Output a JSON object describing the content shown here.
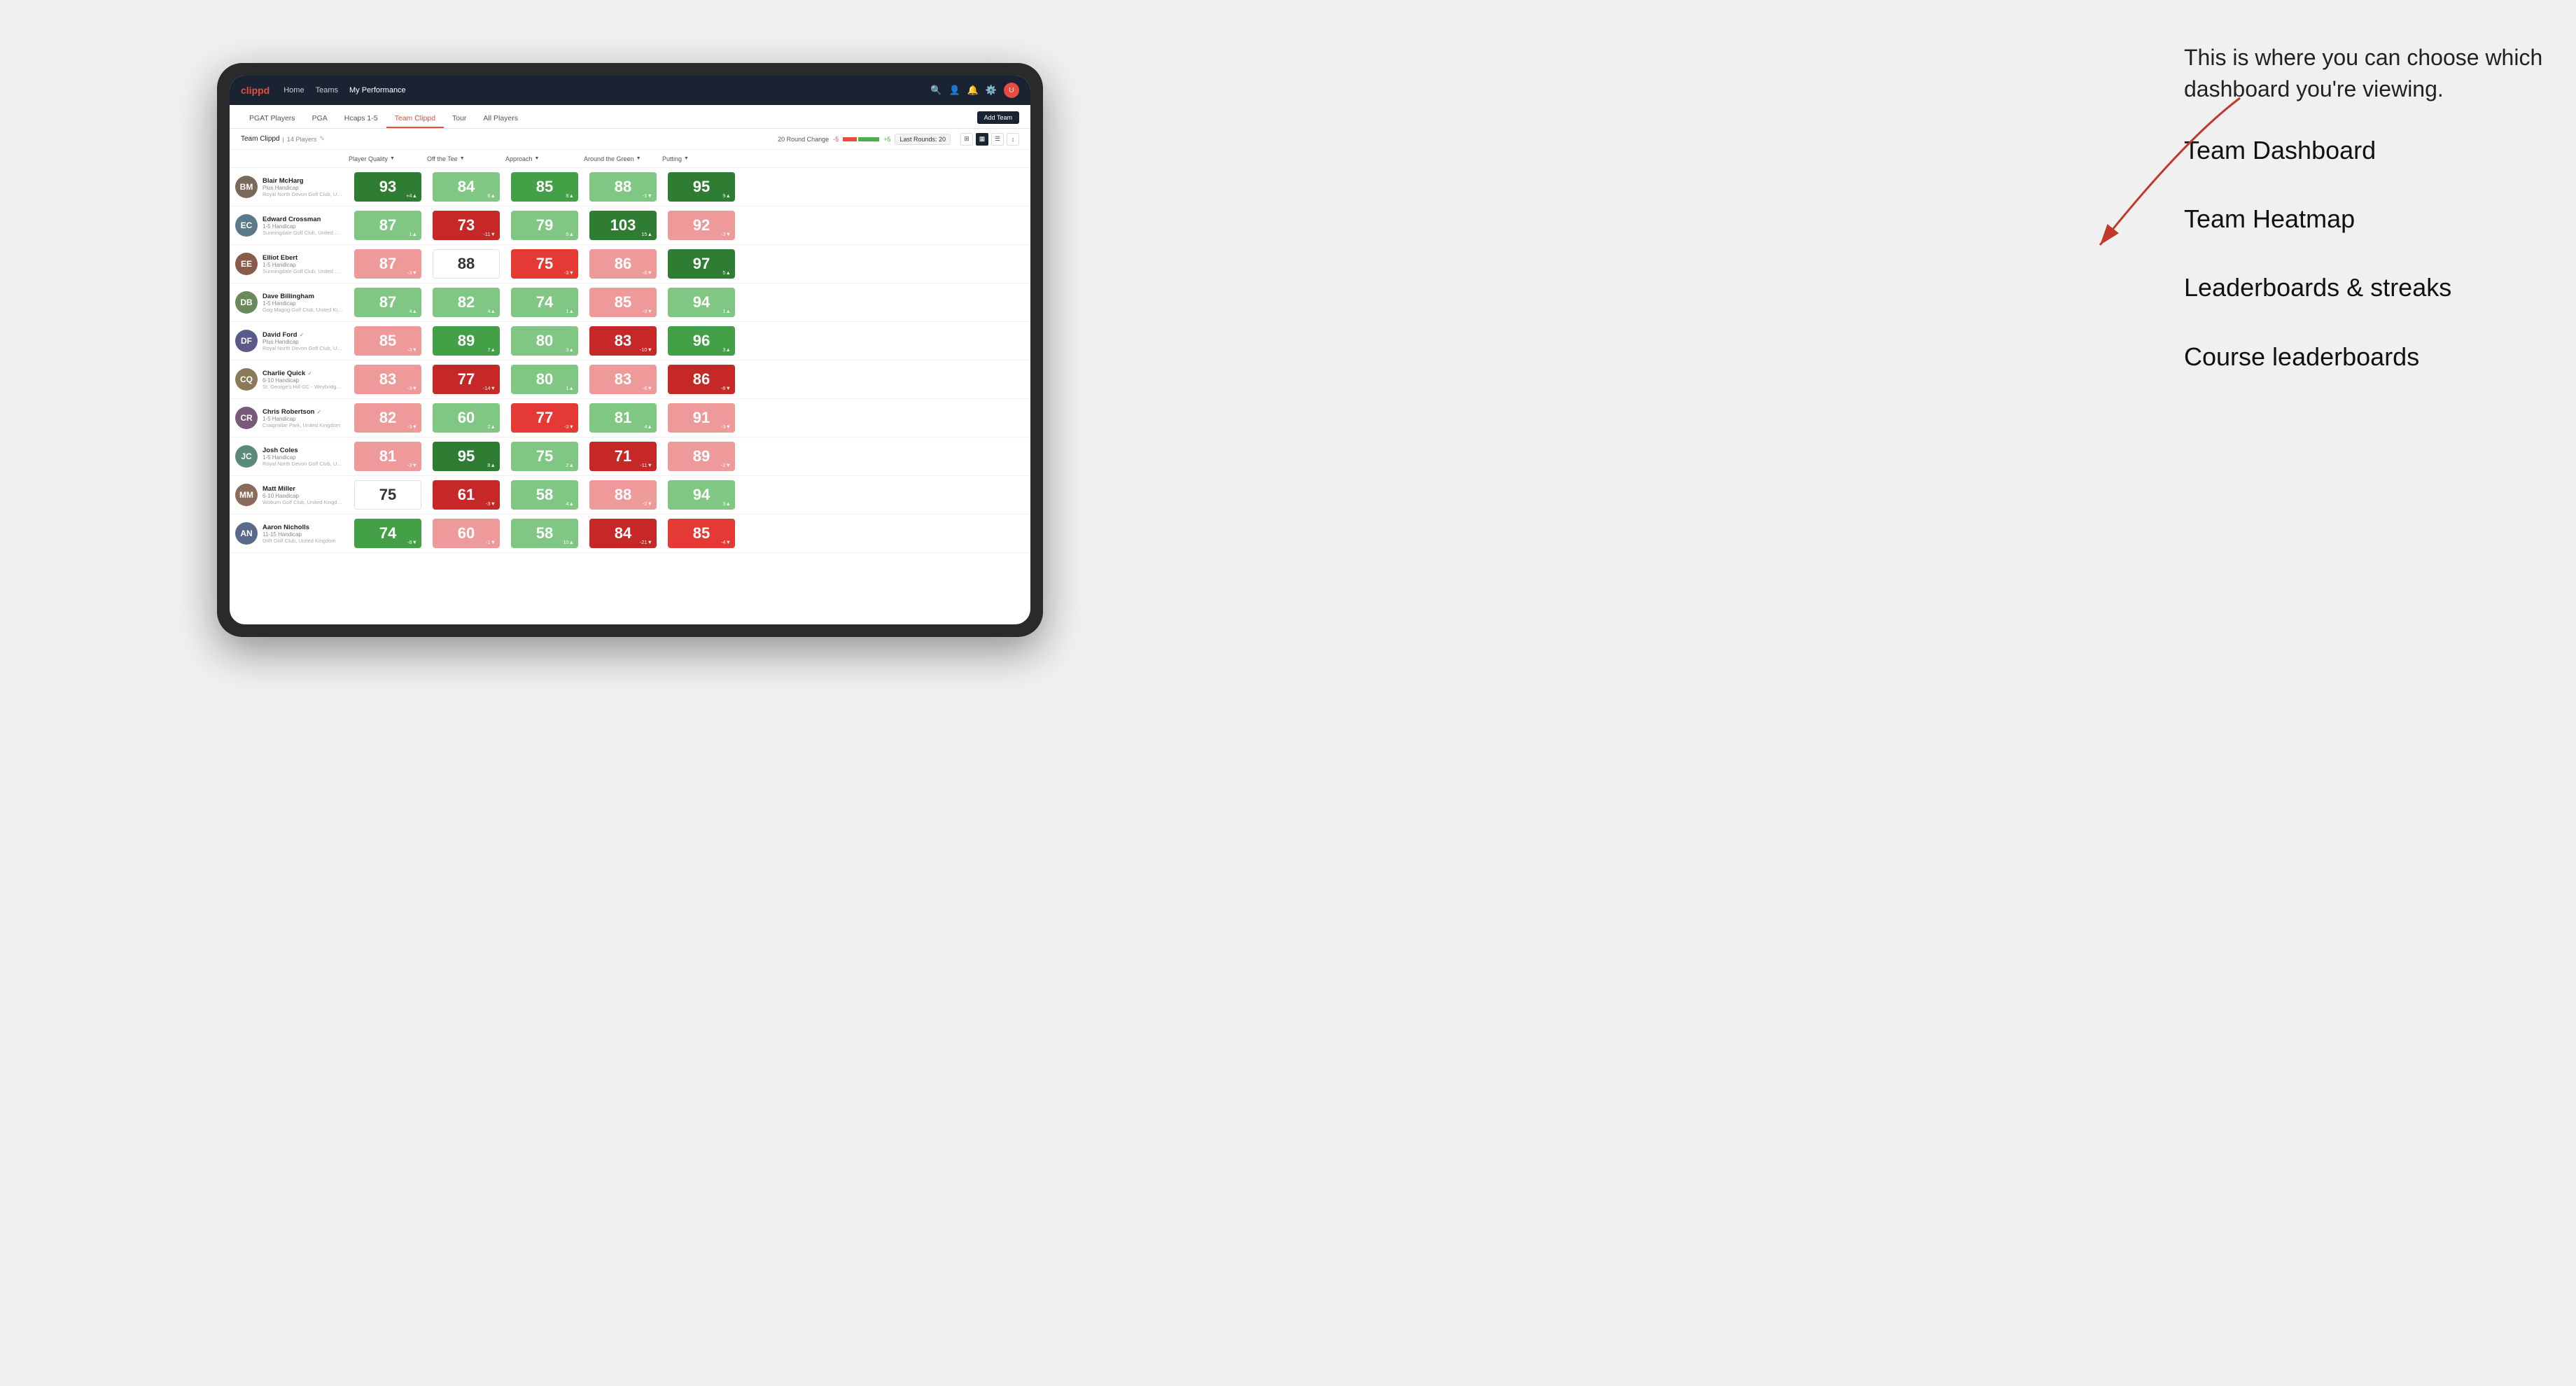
{
  "annotation": {
    "intro": "This is where you can choose which dashboard you're viewing.",
    "items": [
      "Team Dashboard",
      "Team Heatmap",
      "Leaderboards & streaks",
      "Course leaderboards"
    ]
  },
  "nav": {
    "logo": "clippd",
    "items": [
      "Home",
      "Teams",
      "My Performance"
    ],
    "active": "My Performance"
  },
  "sub_tabs": {
    "tabs": [
      "PGAT Players",
      "PGA",
      "Hcaps 1-5",
      "Team Clippd",
      "Tour",
      "All Players"
    ],
    "active": "Team Clippd",
    "add_team": "Add Team"
  },
  "team_bar": {
    "name": "Team Clippd",
    "separator": "|",
    "count": "14 Players",
    "round_change_label": "20 Round Change",
    "neg_label": "-5",
    "pos_label": "+5",
    "last_rounds": "Last Rounds: 20"
  },
  "column_headers": {
    "player": "Player Quality",
    "tee": "Off the Tee",
    "approach": "Approach",
    "green": "Around the Green",
    "putting": "Putting"
  },
  "players": [
    {
      "name": "Blair McHarg",
      "handicap": "Plus Handicap",
      "club": "Royal North Devon Golf Club, United Kingdom",
      "avatar_color": "#7a6a5a",
      "initials": "BM",
      "quality": {
        "value": 93,
        "change": "+4",
        "dir": "up",
        "color": "green-dark"
      },
      "tee": {
        "value": 84,
        "change": "6",
        "dir": "up",
        "color": "green-light"
      },
      "approach": {
        "value": 85,
        "change": "8",
        "dir": "up",
        "color": "green-mid"
      },
      "green": {
        "value": 88,
        "change": "-1",
        "dir": "down",
        "color": "green-light"
      },
      "putting": {
        "value": 95,
        "change": "9",
        "dir": "up",
        "color": "green-dark"
      }
    },
    {
      "name": "Edward Crossman",
      "handicap": "1-5 Handicap",
      "club": "Sunningdale Golf Club, United Kingdom",
      "avatar_color": "#5a7a8a",
      "initials": "EC",
      "quality": {
        "value": 87,
        "change": "1",
        "dir": "up",
        "color": "green-light"
      },
      "tee": {
        "value": 73,
        "change": "-11",
        "dir": "down",
        "color": "red-dark"
      },
      "approach": {
        "value": 79,
        "change": "9",
        "dir": "up",
        "color": "green-light"
      },
      "green": {
        "value": 103,
        "change": "15",
        "dir": "up",
        "color": "green-dark"
      },
      "putting": {
        "value": 92,
        "change": "-3",
        "dir": "down",
        "color": "red-light"
      }
    },
    {
      "name": "Elliot Ebert",
      "handicap": "1-5 Handicap",
      "club": "Sunningdale Golf Club, United Kingdom",
      "avatar_color": "#8a5a4a",
      "initials": "EE",
      "quality": {
        "value": 87,
        "change": "-3",
        "dir": "down",
        "color": "red-light"
      },
      "tee": {
        "value": 88,
        "change": "",
        "dir": "neutral",
        "color": "neutral"
      },
      "approach": {
        "value": 75,
        "change": "-3",
        "dir": "down",
        "color": "red-mid"
      },
      "green": {
        "value": 86,
        "change": "-6",
        "dir": "down",
        "color": "red-light"
      },
      "putting": {
        "value": 97,
        "change": "5",
        "dir": "up",
        "color": "green-dark"
      }
    },
    {
      "name": "Dave Billingham",
      "handicap": "1-5 Handicap",
      "club": "Gog Magog Golf Club, United Kingdom",
      "avatar_color": "#6a8a5a",
      "initials": "DB",
      "quality": {
        "value": 87,
        "change": "4",
        "dir": "up",
        "color": "green-light"
      },
      "tee": {
        "value": 82,
        "change": "4",
        "dir": "up",
        "color": "green-light"
      },
      "approach": {
        "value": 74,
        "change": "1",
        "dir": "up",
        "color": "green-light"
      },
      "green": {
        "value": 85,
        "change": "-3",
        "dir": "down",
        "color": "red-light"
      },
      "putting": {
        "value": 94,
        "change": "1",
        "dir": "up",
        "color": "green-light"
      }
    },
    {
      "name": "David Ford",
      "handicap": "Plus Handicap",
      "club": "Royal North Devon Golf Club, United Kingdom",
      "avatar_color": "#5a5a8a",
      "initials": "DF",
      "verified": true,
      "quality": {
        "value": 85,
        "change": "-3",
        "dir": "down",
        "color": "red-light"
      },
      "tee": {
        "value": 89,
        "change": "7",
        "dir": "up",
        "color": "green-mid"
      },
      "approach": {
        "value": 80,
        "change": "3",
        "dir": "up",
        "color": "green-light"
      },
      "green": {
        "value": 83,
        "change": "-10",
        "dir": "down",
        "color": "red-dark"
      },
      "putting": {
        "value": 96,
        "change": "3",
        "dir": "up",
        "color": "green-mid"
      }
    },
    {
      "name": "Charlie Quick",
      "handicap": "6-10 Handicap",
      "club": "St. George's Hill GC - Weybridge - Surrey, Uni...",
      "avatar_color": "#8a7a5a",
      "initials": "CQ",
      "verified": true,
      "quality": {
        "value": 83,
        "change": "-3",
        "dir": "down",
        "color": "red-light"
      },
      "tee": {
        "value": 77,
        "change": "-14",
        "dir": "down",
        "color": "red-dark"
      },
      "approach": {
        "value": 80,
        "change": "1",
        "dir": "up",
        "color": "green-light"
      },
      "green": {
        "value": 83,
        "change": "-6",
        "dir": "down",
        "color": "red-light"
      },
      "putting": {
        "value": 86,
        "change": "-8",
        "dir": "down",
        "color": "red-dark"
      }
    },
    {
      "name": "Chris Robertson",
      "handicap": "1-5 Handicap",
      "club": "Craigmillar Park, United Kingdom",
      "avatar_color": "#7a5a7a",
      "initials": "CR",
      "verified": true,
      "quality": {
        "value": 82,
        "change": "-3",
        "dir": "down",
        "color": "red-light"
      },
      "tee": {
        "value": 60,
        "change": "2",
        "dir": "up",
        "color": "green-light"
      },
      "approach": {
        "value": 77,
        "change": "-3",
        "dir": "down",
        "color": "red-mid"
      },
      "green": {
        "value": 81,
        "change": "4",
        "dir": "up",
        "color": "green-light"
      },
      "putting": {
        "value": 91,
        "change": "-3",
        "dir": "down",
        "color": "red-light"
      }
    },
    {
      "name": "Josh Coles",
      "handicap": "1-5 Handicap",
      "club": "Royal North Devon Golf Club, United Kingdom",
      "avatar_color": "#5a8a7a",
      "initials": "JC",
      "quality": {
        "value": 81,
        "change": "-3",
        "dir": "down",
        "color": "red-light"
      },
      "tee": {
        "value": 95,
        "change": "8",
        "dir": "up",
        "color": "green-dark"
      },
      "approach": {
        "value": 75,
        "change": "2",
        "dir": "up",
        "color": "green-light"
      },
      "green": {
        "value": 71,
        "change": "-11",
        "dir": "down",
        "color": "red-dark"
      },
      "putting": {
        "value": 89,
        "change": "-2",
        "dir": "down",
        "color": "red-light"
      }
    },
    {
      "name": "Matt Miller",
      "handicap": "6-10 Handicap",
      "club": "Woburn Golf Club, United Kingdom",
      "avatar_color": "#8a6a5a",
      "initials": "MM",
      "quality": {
        "value": 75,
        "change": "",
        "dir": "neutral",
        "color": "neutral"
      },
      "tee": {
        "value": 61,
        "change": "-3",
        "dir": "down",
        "color": "red-dark"
      },
      "approach": {
        "value": 58,
        "change": "4",
        "dir": "up",
        "color": "green-light"
      },
      "green": {
        "value": 88,
        "change": "-2",
        "dir": "down",
        "color": "red-light"
      },
      "putting": {
        "value": 94,
        "change": "3",
        "dir": "up",
        "color": "green-light"
      }
    },
    {
      "name": "Aaron Nicholls",
      "handicap": "11-15 Handicap",
      "club": "Drift Golf Club, United Kingdom",
      "avatar_color": "#5a6a8a",
      "initials": "AN",
      "quality": {
        "value": 74,
        "change": "-8",
        "dir": "down",
        "color": "green-mid"
      },
      "tee": {
        "value": 60,
        "change": "-1",
        "dir": "down",
        "color": "red-light"
      },
      "approach": {
        "value": 58,
        "change": "10",
        "dir": "up",
        "color": "green-light"
      },
      "green": {
        "value": 84,
        "change": "-21",
        "dir": "down",
        "color": "red-dark"
      },
      "putting": {
        "value": 85,
        "change": "-4",
        "dir": "down",
        "color": "red-mid"
      }
    }
  ]
}
